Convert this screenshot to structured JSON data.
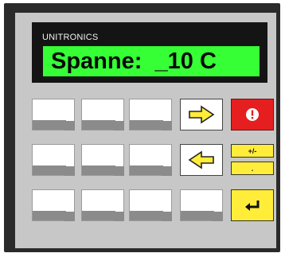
{
  "device": {
    "brand": "UNITRONICS",
    "display_text": "Spanne:  _10 C"
  },
  "keys": {
    "plus_minus_label": "+/-",
    "decimal_label": "."
  },
  "colors": {
    "lcd": "#36ff36",
    "alarm": "#e51f1f",
    "arrow_fill": "#ffed3a",
    "function_keys": "#ffed3a"
  },
  "icons": [
    "arrow-right-icon",
    "arrow-left-icon",
    "alarm-icon",
    "enter-icon"
  ]
}
